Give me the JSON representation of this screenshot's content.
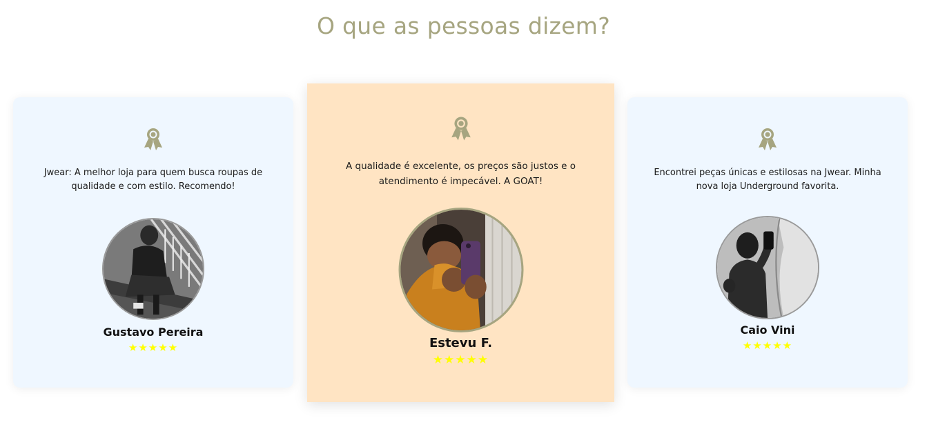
{
  "section": {
    "title": "O que as pessoas dizem?"
  },
  "colors": {
    "title": "#a6a580",
    "side_card_bg": "#eff7ff",
    "featured_card_bg": "#ffe4c3",
    "star": "#ffff00",
    "icon": "#a6a580"
  },
  "testimonials": [
    {
      "icon": "award-ribbon-icon",
      "quote": "Jwear: A melhor loja para quem busca roupas de qualidade e com estilo. Recomendo!",
      "name": "Gustavo Pereira",
      "stars": "★★★★★",
      "rating": 5
    },
    {
      "icon": "award-ribbon-icon",
      "quote": "A qualidade é excelente, os preços são justos e o atendimento é impecável. A GOAT!",
      "name": "Estevu F.",
      "stars": "★★★★★",
      "rating": 5
    },
    {
      "icon": "award-ribbon-icon",
      "quote": "Encontrei peças únicas e estilosas na Jwear. Minha nova loja Underground favorita.",
      "name": "Caio Vini",
      "stars": "★★★★★",
      "rating": 5
    }
  ]
}
